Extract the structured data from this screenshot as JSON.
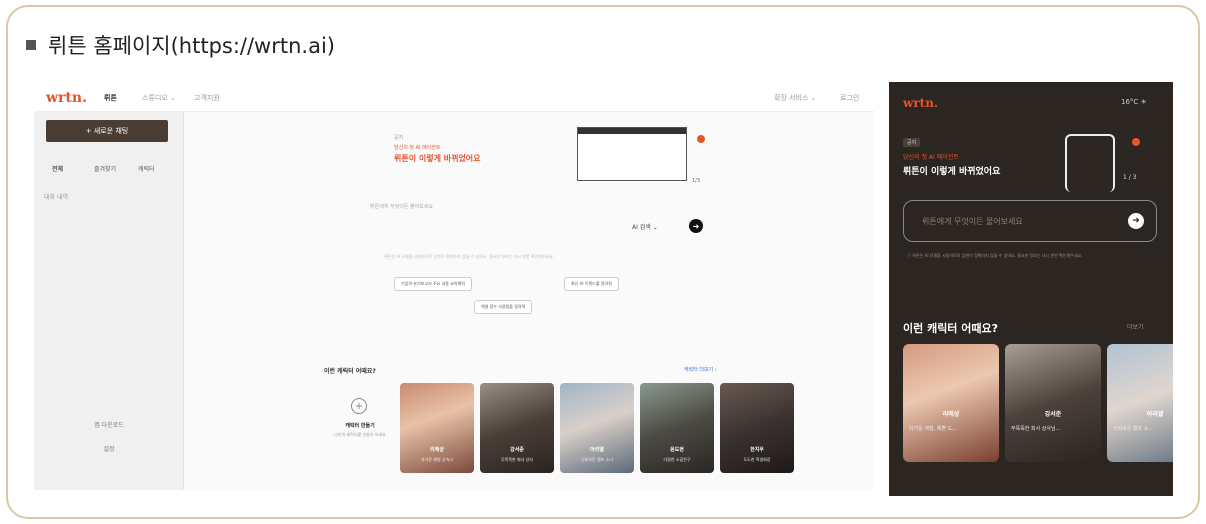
{
  "caption": "뤼튼 홈페이지(https://wrtn.ai)",
  "desktop": {
    "logo": "wrtn.",
    "nav": [
      "뤼튼",
      "스튜디오 ⌄",
      "고객지원"
    ],
    "top_right": [
      "확장 서비스 ⌄",
      "로그인"
    ],
    "new_chat": "+ 새로운 채팅",
    "side_tabs": [
      "전체",
      "즐겨찾기",
      "캐릭터"
    ],
    "side_item": "대화 내역",
    "side_foot": [
      "앱 다운로드",
      "설정"
    ],
    "promo_label": "공지",
    "promo_small": "당신의 첫 AI 에이전트",
    "promo_title": "뤼튼이 이렇게 바뀌었어요",
    "promo_page": "1/3",
    "hint": "뤼튼에게 무엇이든 물어보세요",
    "model": "AI 검색 ⌄",
    "send": "➜",
    "notice": "뤼튼은 AI 모델을 사용하므로 답변이 정확하지 않을 수 있어요. 중요한 정보는 다시 한번 확인해주세요.",
    "chips": [
      "기업의 분기보고서 주요 내용 요약해줘",
      "최신 AI 트렌드를 알려줘",
      "엑셀 함수 사용법을 알려줘"
    ],
    "section": "이런 캐릭터 어때요?",
    "more": "캐릭터 더보기 ›",
    "make_char": "캐릭터 만들기",
    "make_char_sub": "나만의 캐릭터를 만들어 보세요",
    "cards": [
      {
        "name": "리에샹",
        "desc": "차가운 재벌 상속녀"
      },
      {
        "name": "강서준",
        "desc": "무뚝뚝한 회사 상사"
      },
      {
        "name": "아리엘",
        "desc": "신비로운 엘프 소녀"
      },
      {
        "name": "윤도현",
        "desc": "다정한 소꿉친구"
      },
      {
        "name": "한지우",
        "desc": "도도한 학생회장"
      }
    ]
  },
  "mobile": {
    "logo": "wrtn.",
    "temp": "16°C ☀",
    "badge": "공지",
    "promo_small": "당신의 첫 AI 에이전트",
    "promo_title": "뤼튼이 이렇게 바뀌었어요",
    "page": "1 / 3",
    "placeholder": "뤼튼에게 무엇이든 물어보세요",
    "go": "➜",
    "note": "ⓘ 뤼튼은 AI 모델을 사용하므로 답변이 정확하지 않을 수 있어요. 중요한 정보는 다시 한번 확인해주세요.",
    "section": "이런 캐릭터 어때요?",
    "more": "더보기",
    "cards": [
      {
        "name": "리에샹",
        "desc": "차가운 재벌, 예쁜 드..."
      },
      {
        "name": "강서준",
        "desc": "무뚝뚝한 회사 상사님..."
      },
      {
        "name": "아리엘",
        "desc": "신비로운 엘프 소..."
      }
    ]
  }
}
